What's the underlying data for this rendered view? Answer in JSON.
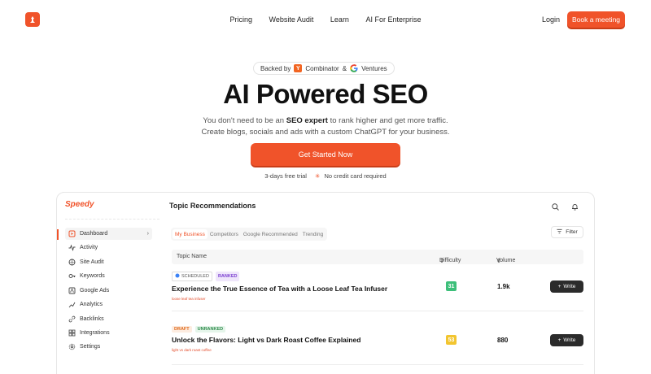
{
  "nav": {
    "links": [
      "Pricing",
      "Website Audit",
      "Learn",
      "AI For Enterprise"
    ],
    "login": "Login",
    "book": "Book a meeting"
  },
  "hero": {
    "backed_prefix": "Backed by",
    "yc_letter": "Y",
    "combinator": "Combinator",
    "amp": "&",
    "ventures": "Ventures",
    "title": "AI Powered SEO",
    "sub_a": "You don't need to be an",
    "sub_bold": "SEO expert",
    "sub_b": "to rank higher and get more traffic.",
    "sub_line2": "Create blogs, socials and ads with a custom ChatGPT for your business.",
    "cta": "Get Started Now",
    "trial": "3-days free trial",
    "no_card": "No credit card required"
  },
  "app": {
    "brand": "Speedy",
    "title": "Topic Recommendations",
    "sidebar": [
      {
        "label": "Dashboard",
        "icon": "dashboard-icon"
      },
      {
        "label": "Activity",
        "icon": "activity-icon"
      },
      {
        "label": "Site Audit",
        "icon": "site-audit-icon"
      },
      {
        "label": "Keywords",
        "icon": "keywords-icon"
      },
      {
        "label": "Google Ads",
        "icon": "google-ads-icon"
      },
      {
        "label": "Analytics",
        "icon": "analytics-icon"
      },
      {
        "label": "Backlinks",
        "icon": "backlinks-icon"
      },
      {
        "label": "Integrations",
        "icon": "integrations-icon"
      },
      {
        "label": "Settings",
        "icon": "settings-icon"
      }
    ],
    "tabs": [
      "My Business",
      "Competitors",
      "Google Recommended",
      "Trending"
    ],
    "filter": "Filter",
    "columns": {
      "topic": "Topic Name",
      "difficulty": "Difficulty",
      "volume": "Volume"
    },
    "rows": [
      {
        "badge1": "SCHEDULED",
        "badge2": "RANKED",
        "title": "Experience the True Essence of Tea with a Loose Leaf Tea Infuser",
        "keyword": "loose leaf tea infuser",
        "difficulty": "31",
        "volume": "1.9k",
        "action": "Write"
      },
      {
        "badge1": "DRAFT",
        "badge2": "UNRANKED",
        "title": "Unlock the Flavors: Light vs Dark Roast Coffee Explained",
        "keyword": "light vs dark roast coffee",
        "difficulty": "53",
        "volume": "880",
        "action": "Write"
      }
    ],
    "colors": {
      "accent": "#f0532a",
      "diff_easy": "#3dbf7a",
      "diff_mid": "#f2c530"
    }
  }
}
